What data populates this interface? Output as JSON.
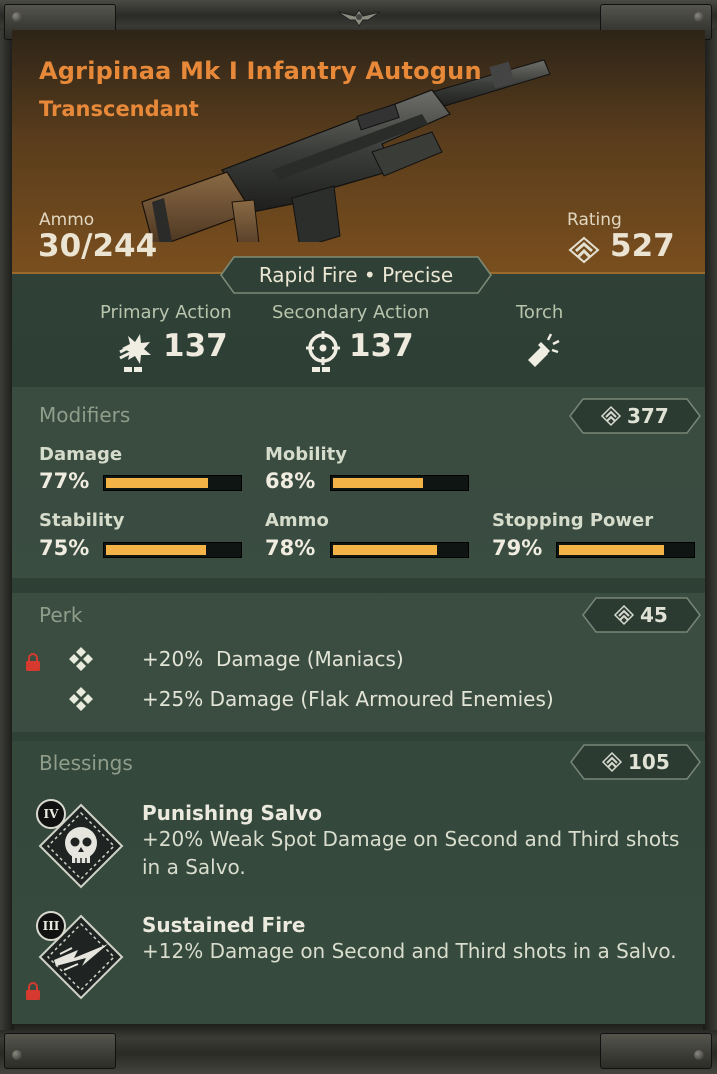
{
  "weapon": {
    "name": "Agripinaa Mk I Infantry Autogun",
    "rarity": "Transcendant",
    "ammo_label": "Ammo",
    "ammo_value": "30/244",
    "rating_label": "Rating",
    "rating_value": "527",
    "tags": "Rapid Fire • Precise"
  },
  "actions": [
    {
      "label": "Primary Action",
      "value": "137",
      "icon": "burst-fire-icon"
    },
    {
      "label": "Secondary Action",
      "value": "137",
      "icon": "crosshair-icon"
    },
    {
      "label": "Torch",
      "value": "",
      "icon": "flashlight-icon"
    }
  ],
  "modifiers": {
    "title": "Modifiers",
    "badge": "377",
    "stats": [
      {
        "label": "Damage",
        "value": "77%",
        "fill": 0.77
      },
      {
        "label": "Mobility",
        "value": "68%",
        "fill": 0.68
      },
      {
        "label": "Stability",
        "value": "75%",
        "fill": 0.75
      },
      {
        "label": "Ammo",
        "value": "78%",
        "fill": 0.78
      },
      {
        "label": "Stopping Power",
        "value": "79%",
        "fill": 0.79
      }
    ]
  },
  "perk": {
    "title": "Perk",
    "badge": "45",
    "lines": [
      {
        "amount": "+20%",
        "text": "Damage (Maniacs)",
        "locked": true
      },
      {
        "amount": "+25%",
        "text": "Damage (Flak Armoured Enemies)",
        "locked": false
      }
    ]
  },
  "blessings": {
    "title": "Blessings",
    "badge": "105",
    "items": [
      {
        "tier": "IV",
        "name": "Punishing Salvo",
        "desc": "+20% Weak Spot Damage on Second and Third shots in a Salvo.",
        "icon": "skull-icon",
        "locked": false
      },
      {
        "tier": "III",
        "name": "Sustained Fire",
        "desc": "+12% Damage on Second and Third shots in a Salvo.",
        "icon": "lightning-icon",
        "locked": true
      }
    ]
  },
  "colors": {
    "accent_orange": "#e8893a",
    "bar_fill": "#f4b347",
    "lock_red": "#d63a2e"
  }
}
